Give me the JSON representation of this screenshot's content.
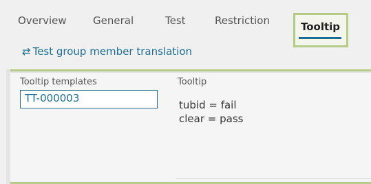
{
  "tabs": {
    "items": [
      "Overview",
      "General",
      "Test",
      "Restriction"
    ],
    "active": "Tooltip"
  },
  "link": {
    "icon": "swap-arrows-icon",
    "label": "Test group member translation"
  },
  "panel": {
    "templates_label": "Tooltip templates",
    "templates_value": "TT-000003",
    "tooltip_label": "Tooltip",
    "tooltip_lines": [
      "tubid = fail",
      "clear = pass"
    ]
  },
  "colors": {
    "accent": "#1e6e94",
    "highlight": "#b6cc86"
  }
}
